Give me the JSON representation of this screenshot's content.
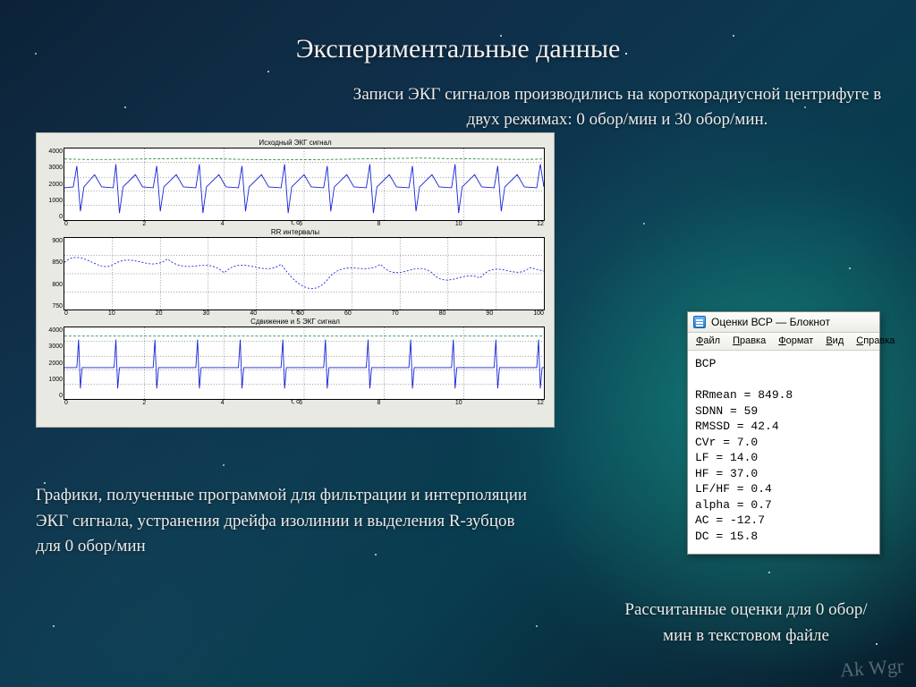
{
  "title": "Экспериментальные данные",
  "subtitle": "Записи ЭКГ сигналов производились на короткорадиусной центрифуге в двух режимах: 0 обор/мин и 30 обор/мин.",
  "figure": {
    "plots": [
      {
        "title": "Исходный ЭКГ сигнал",
        "xlabel": "t, с",
        "yticks": [
          "4000",
          "3000",
          "2000",
          "1000",
          "0"
        ],
        "xticks": [
          "0",
          "2",
          "4",
          "6",
          "8",
          "10",
          "12"
        ]
      },
      {
        "title": "RR интервалы",
        "xlabel": "t, с",
        "yticks": [
          "900",
          "850",
          "800",
          "750"
        ],
        "xticks": [
          "0",
          "10",
          "20",
          "30",
          "40",
          "50",
          "60",
          "70",
          "80",
          "90",
          "100"
        ]
      },
      {
        "title": "Сдвижение и 5 ЭКГ сигнал",
        "xlabel": "t, с",
        "yticks": [
          "4000",
          "3000",
          "2000",
          "1000",
          "0"
        ],
        "xticks": [
          "0",
          "2",
          "4",
          "6",
          "8",
          "10",
          "12"
        ]
      }
    ]
  },
  "caption_left": "Графики, полученные программой для фильтрации и интерполяции ЭКГ сигнала, устранения дрейфа изолинии и выделения R-зубцов для 0 обор/мин",
  "notepad": {
    "title": "Оценки ВСР — Блокнот",
    "menu": [
      "Файл",
      "Правка",
      "Формат",
      "Вид",
      "Справка"
    ],
    "header": "ВСР",
    "metrics": [
      {
        "k": "RRmean",
        "v": "849.8"
      },
      {
        "k": "SDNN",
        "v": "59"
      },
      {
        "k": "RMSSD",
        "v": "42.4"
      },
      {
        "k": "CVr",
        "v": "7.0"
      },
      {
        "k": "LF",
        "v": "14.0"
      },
      {
        "k": "HF",
        "v": "37.0"
      },
      {
        "k": "LF/HF",
        "v": "0.4"
      },
      {
        "k": "alpha",
        "v": "0.7"
      },
      {
        "k": "AC",
        "v": "-12.7"
      },
      {
        "k": "DC",
        "v": "15.8"
      }
    ]
  },
  "caption_right": "Рассчитанные оценки для 0 обор/мин в текстовом файле",
  "signature": "Ak Wgr"
}
